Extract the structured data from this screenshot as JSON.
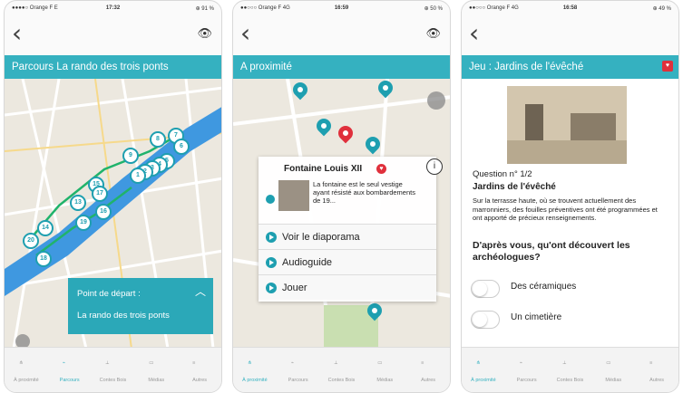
{
  "screens": [
    {
      "status": {
        "carrier": "●●●●○ Orange F  E",
        "time": "17:32",
        "right": "⊕ 91 %"
      },
      "title": "Parcours La rando des trois ponts",
      "map_markers": [
        "8",
        "7",
        "6",
        "9",
        "5",
        "4",
        "3",
        "2",
        "1",
        "13",
        "15",
        "16",
        "17",
        "19",
        "14",
        "20",
        "18"
      ],
      "start_card": {
        "line1": "Point de départ :",
        "line2": "La rando des trois ponts"
      },
      "tabs": [
        "À proximité",
        "Parcours",
        "Contes Bois",
        "Médias",
        "Autres"
      ],
      "active_tab": 1
    },
    {
      "status": {
        "carrier": "●●○○○ Orange F  4G",
        "time": "16:59",
        "right": "⊕ 50 %"
      },
      "title": "A proximité",
      "popup": {
        "title": "Fontaine Louis XII",
        "description": "La fontaine est le seul vestige ayant résisté aux bombardements de 19...",
        "actions": [
          "Voir le diaporama",
          "Audioguide",
          "Jouer"
        ]
      },
      "tabs": [
        "À proximité",
        "Parcours",
        "Contes Bois",
        "Médias",
        "Autres"
      ],
      "active_tab": 0
    },
    {
      "status": {
        "carrier": "●●○○○ Orange F  4G",
        "time": "16:58",
        "right": "⊕ 49 %"
      },
      "title": "Jeu : Jardins de l'évêché",
      "question_number": "Question n° 1/2",
      "question_title": "Jardins de l'évêché",
      "question_text": "Sur la terrasse haute, où se trouvent actuellement des marronniers, des fouilles préventives ont été programmées et ont apporté de précieux renseignements.",
      "question": "D'après vous, qu'ont découvert les archéologues?",
      "answers": [
        "Des céramiques",
        "Un cimetière"
      ],
      "tabs": [
        "À proximité",
        "Parcours",
        "Contes Bois",
        "Médias",
        "Autres"
      ],
      "active_tab": 0
    }
  ],
  "icons": {
    "back": "chevron-left-icon",
    "eye": "eye-icon",
    "info": "info-icon"
  },
  "colors": {
    "teal": "#35b1c0",
    "pin": "#1e9fb0",
    "red": "#e0303c"
  }
}
